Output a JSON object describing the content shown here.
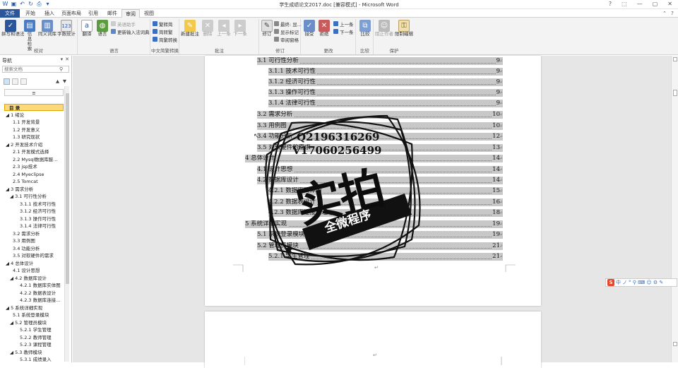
{
  "window": {
    "title": "学生成绩论文2017.doc [兼容模式] - Microsoft Word"
  },
  "tabs": [
    {
      "label": "文件"
    },
    {
      "label": "开始"
    },
    {
      "label": "插入"
    },
    {
      "label": "页面布局"
    },
    {
      "label": "引用"
    },
    {
      "label": "邮件"
    },
    {
      "label": "审阅"
    },
    {
      "label": "视图"
    }
  ],
  "ribbon": {
    "proofing": {
      "label": "校对",
      "spell": "拼写和语法",
      "info": "信息检索",
      "thesaurus": "同义词库",
      "wordcount": "字数统计"
    },
    "language": {
      "label": "语言",
      "translate": "翻译",
      "lang": "语言",
      "english_assist": "英语助手",
      "update_ime": "更新输入法词典"
    },
    "chinese": {
      "label": "中文简繁转换",
      "to_trad": "繁转简",
      "to_simp": "简转繁",
      "convert": "简繁转换"
    },
    "comments": {
      "label": "批注",
      "new": "新建批注",
      "delete": "删除",
      "prev": "上一条",
      "next": "下一条"
    },
    "tracking": {
      "label": "修订",
      "track": "修订",
      "final_show": "最终: 显...",
      "show_markup": "显示标记",
      "review_pane": "审阅窗格"
    },
    "changes": {
      "label": "更改",
      "accept": "接受",
      "reject": "拒绝",
      "prev": "上一条",
      "next": "下一条"
    },
    "compare": {
      "label": "比较",
      "compare": "比较"
    },
    "protect": {
      "label": "保护",
      "block_authors": "阻止作者",
      "restrict": "限制编辑"
    }
  },
  "nav": {
    "title": "导航",
    "search_placeholder": "搜索文档",
    "items": [
      {
        "label": "≡"
      },
      {
        "label": "目  录"
      },
      {
        "label": "◢ 1  绪论"
      },
      {
        "label": "1.1  开发背景"
      },
      {
        "label": "1.2  开发意义"
      },
      {
        "label": "1.3  研究现状"
      },
      {
        "label": "◢ 2  开发技术介绍"
      },
      {
        "label": "2.1  开发模式选择"
      },
      {
        "label": "2.2  Mysql数据库服..."
      },
      {
        "label": "2.3  jsp技术"
      },
      {
        "label": "2.4  Myeclipse"
      },
      {
        "label": "2.5  Tomcat"
      },
      {
        "label": "◢ 3  需求分析"
      },
      {
        "label": "◢ 3.1  可行性分析"
      },
      {
        "label": "3.1.1  技术可行性"
      },
      {
        "label": "3.1.2  经济可行性"
      },
      {
        "label": "3.1.3  操作可行性"
      },
      {
        "label": "3.1.4  法律可行性"
      },
      {
        "label": "3.2  需求分析"
      },
      {
        "label": "3.3  用例图"
      },
      {
        "label": "3.4  功能分析"
      },
      {
        "label": "3.5  对软硬件的需求"
      },
      {
        "label": "◢ 4  总体设计"
      },
      {
        "label": "4.1  设计思想"
      },
      {
        "label": "◢ 4.2  数据库设计"
      },
      {
        "label": "4.2.1  数据库实体图"
      },
      {
        "label": "4.2.2  数据表设计"
      },
      {
        "label": "4.2.3  数据库连接..."
      },
      {
        "label": "◢ 5  系统详细实现"
      },
      {
        "label": "5.1  系统登录模块"
      },
      {
        "label": "◢ 5.2  管理员模块"
      },
      {
        "label": "5.2.1  学生管理"
      },
      {
        "label": "5.2.2  教师管理"
      },
      {
        "label": "5.2.3  课程管理"
      },
      {
        "label": "◢ 5.3  教师模块"
      },
      {
        "label": "5.3.1  成绩录入"
      }
    ]
  },
  "toc": [
    {
      "text": "3.1  可行性分析",
      "page": "9"
    },
    {
      "text": "3.1.1  技术可行性",
      "page": "9"
    },
    {
      "text": "3.1.2  经济可行性",
      "page": "9"
    },
    {
      "text": "3.1.3  操作可行性",
      "page": "9"
    },
    {
      "text": "3.1.4  法律可行性",
      "page": "9"
    },
    {
      "text": "3.2  需求分析",
      "page": "10"
    },
    {
      "text": "3.3  用例图",
      "page": "10"
    },
    {
      "text": "3.4  功能分析",
      "page": "12"
    },
    {
      "text": "3.5  对软硬件的需求",
      "page": "13"
    },
    {
      "text": "4  总体设计",
      "page": "14"
    },
    {
      "text": "4.1  设计思想",
      "page": "14"
    },
    {
      "text": "4.2  数据库设计",
      "page": "14"
    },
    {
      "text": "4.2.1  数据库实体图",
      "page": "15"
    },
    {
      "text": "4.2.2  数据表设计",
      "page": "16"
    },
    {
      "text": "4.2.3  数据库连接原理",
      "page": "18"
    },
    {
      "text": "5  系统详细实现",
      "page": "19"
    },
    {
      "text": "5.1  系统登录模块",
      "page": "19"
    },
    {
      "text": "5.2  管理员模块",
      "page": "21"
    },
    {
      "text": "5.2.1  学生管理",
      "page": "21"
    }
  ],
  "stamp": {
    "line1": "Q2196316269",
    "line2": "V17060256499",
    "big": "实拍",
    "ribbon": "全微程序"
  },
  "ime": {
    "s": "S",
    "mode": "中",
    "punct": "ノ",
    "symbols": "° ⚲ ⌨ ☺ ⚙ ✎"
  },
  "paragraph_mark": "↵"
}
